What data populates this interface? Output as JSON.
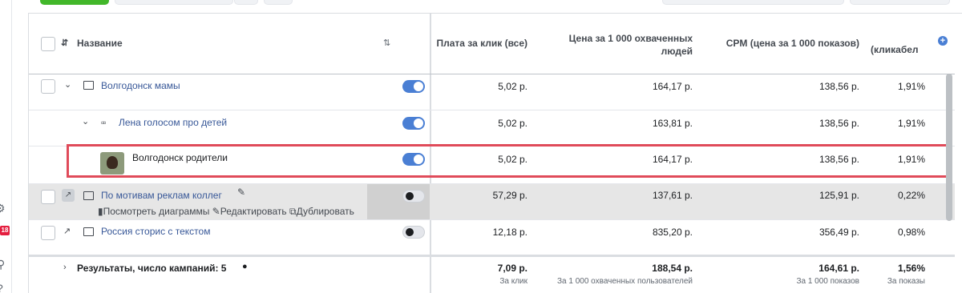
{
  "left_nav": {
    "notification_count": "18"
  },
  "table": {
    "headers": {
      "name": "Название",
      "cpc": "Плата за клик (все)",
      "cost_per_1000_reached": "Цена за 1 000 охваченных людей",
      "cpm": "CPM (цена за 1 000 показов)",
      "ctr": "(кликабел"
    },
    "rows": [
      {
        "name": "Волгодонск мамы",
        "cpc": "5,02 р.",
        "cost_reach": "164,17 р.",
        "cpm": "138,56 р.",
        "ctr": "1,91%"
      },
      {
        "name": "Лена голосом про детей",
        "cpc": "5,02 р.",
        "cost_reach": "163,81 р.",
        "cpm": "138,56 р.",
        "ctr": "1,91%"
      },
      {
        "name": "Волгодонск родители",
        "cpc": "5,02 р.",
        "cost_reach": "164,17 р.",
        "cpm": "138,56 р.",
        "ctr": "1,91%"
      },
      {
        "name": "По мотивам реклам коллег",
        "cpc": "57,29 р.",
        "cost_reach": "137,61 р.",
        "cpm": "125,91 р.",
        "ctr": "0,22%"
      },
      {
        "name": "Россия сторис с текстом",
        "cpc": "12,18 р.",
        "cost_reach": "835,20 р.",
        "cpm": "356,49 р.",
        "ctr": "0,98%"
      }
    ],
    "row_actions": {
      "view_charts": "Посмотреть диаграммы",
      "edit": "Редактировать",
      "duplicate": "Дублировать"
    },
    "summary": {
      "label": "Результаты, число кампаний: 5",
      "cpc": "7,09 р.",
      "cpc_sub": "За клик",
      "cost_reach": "188,54 р.",
      "cost_reach_sub": "За 1 000 охваченных пользователей",
      "cpm": "164,61 р.",
      "cpm_sub": "За 1 000 показов",
      "ctr": "1,56%",
      "ctr_sub": "За показы"
    }
  },
  "colors": {
    "link": "#385898",
    "highlight_border": "#e04b5a",
    "toggle_on": "#4a7fd4"
  }
}
